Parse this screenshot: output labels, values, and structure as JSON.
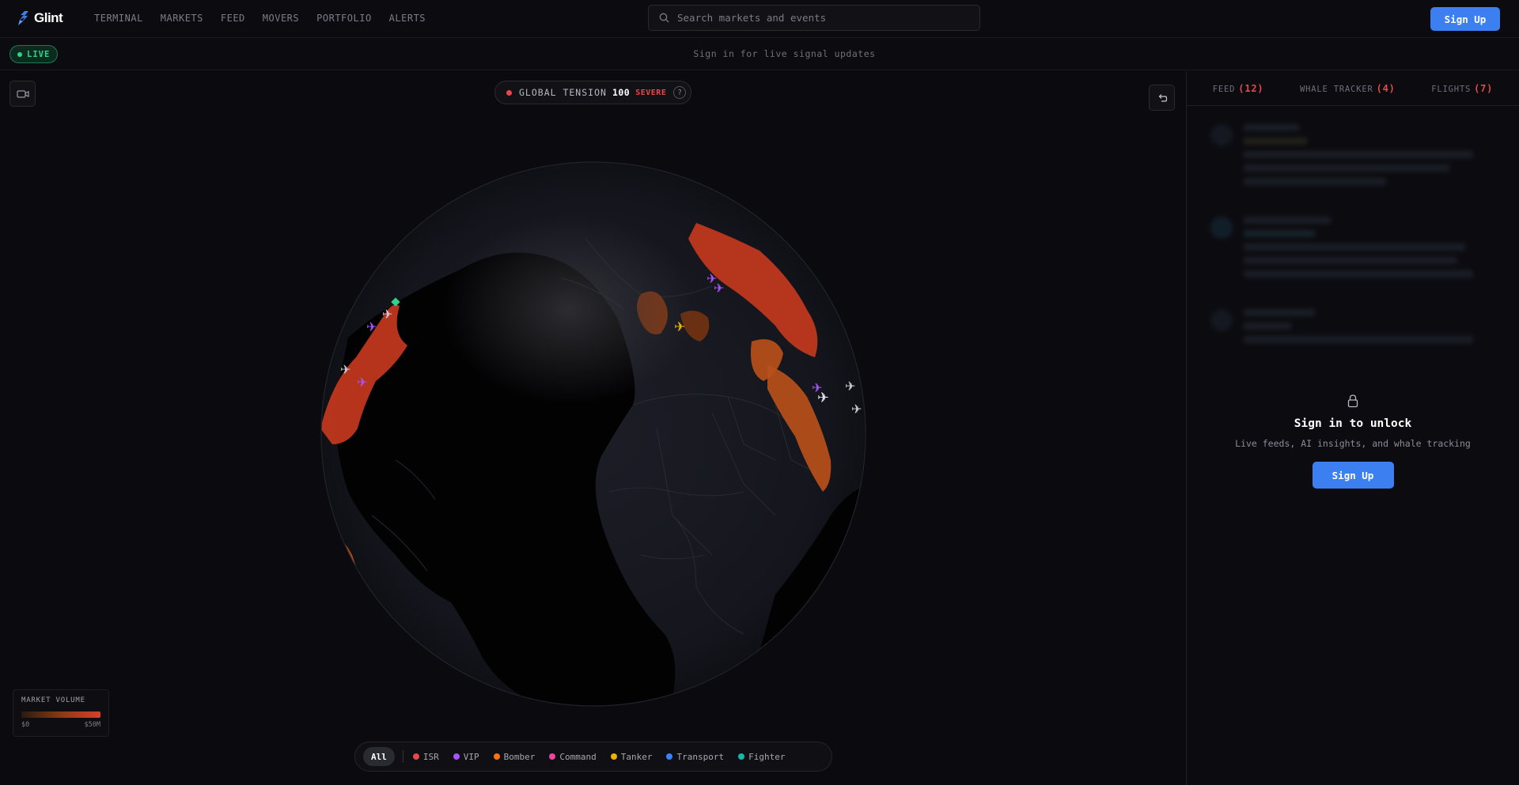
{
  "header": {
    "logo_text": "Glint",
    "nav": [
      "TERMINAL",
      "MARKETS",
      "FEED",
      "MOVERS",
      "PORTFOLIO",
      "ALERTS"
    ],
    "search_placeholder": "Search markets and events",
    "signup_label": "Sign Up"
  },
  "subbar": {
    "live_label": "LIVE",
    "note": "Sign in for live signal updates"
  },
  "tension": {
    "label": "GLOBAL TENSION",
    "value": "100",
    "severity": "SEVERE",
    "help": "?"
  },
  "legend": {
    "title": "MARKET VOLUME",
    "min": "$0",
    "max": "$50M"
  },
  "filters": {
    "all_label": "All",
    "items": [
      {
        "label": "ISR",
        "color": "#e5484d"
      },
      {
        "label": "VIP",
        "color": "#a855f7"
      },
      {
        "label": "Bomber",
        "color": "#f97316"
      },
      {
        "label": "Command",
        "color": "#ec4899"
      },
      {
        "label": "Tanker",
        "color": "#eab308"
      },
      {
        "label": "Transport",
        "color": "#3b82f6"
      },
      {
        "label": "Fighter",
        "color": "#14b8a6"
      }
    ]
  },
  "sidebar": {
    "tabs": [
      {
        "label": "FEED",
        "count": "(12)"
      },
      {
        "label": "WHALE TRACKER",
        "count": "(4)"
      },
      {
        "label": "FLIGHTS",
        "count": "(7)"
      }
    ],
    "lock_title": "Sign in to unlock",
    "lock_subtitle": "Live feeds, AI insights, and whale tracking",
    "signup_label": "Sign Up"
  },
  "colors": {
    "accent": "#3b7ff0",
    "live": "#31d18b",
    "severe": "#e5484d"
  }
}
